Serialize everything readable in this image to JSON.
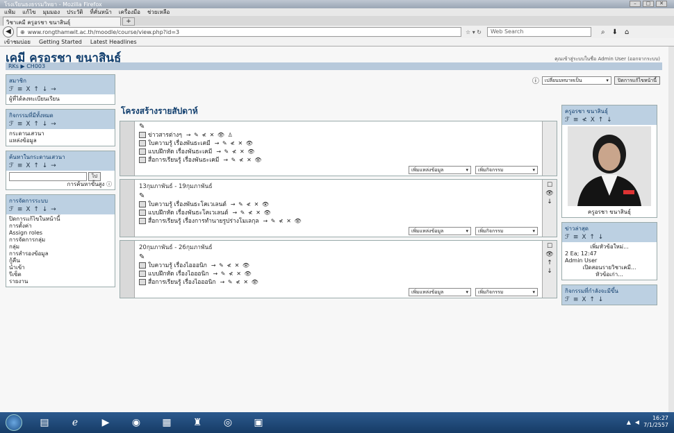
{
  "browser": {
    "title": "โรงเรียนธงธรรมวิทยา - Mozilla Firefox",
    "menu": [
      "แฟ้ม",
      "แก้ไข",
      "มุมมอง",
      "ประวัติ",
      "ที่คั่นหน้า",
      "เครื่องมือ",
      "ช่วยเหลือ"
    ],
    "tab_label": "วิชาเคมี ครูอรชา ขนาสินธุ์",
    "url": "www.rongthamwit.ac.th/moodle/course/view.php?id=3",
    "search_placeholder": "Web Search",
    "bookmarks": [
      "เข้าชมบ่อย",
      "Getting Started",
      "Latest Headlines"
    ]
  },
  "page": {
    "site_title": "เคมี ครูอรชา ขนาสินธุ์",
    "breadcrumb": "RKs ▶ CH003",
    "login_info": "คุณเข้าสู่ระบบในชื่อ Admin User (ออกจากระบบ)",
    "role_select": "เปลี่ยนบทบาทเป็น",
    "turn_edit_btn": "ปิดการแก้ไขหน้านี้"
  },
  "left_blocks": [
    {
      "title": "สมาชิก",
      "controls": "ℱ ≡ X ↑ ↓ →",
      "items": [
        "ผู้ที่ได้ลงทะเบียนเรียน"
      ]
    },
    {
      "title": "กิจกรรมที่มีทั้งหมด",
      "controls": "ℱ ≡ X ↑ ↓ →",
      "items": [
        "กระดานเสวนา",
        "แหล่งข้อมูล"
      ]
    },
    {
      "title": "ค้นหาในกระดานเสวนา",
      "controls": "ℱ ≡ X ↑ ↓ →",
      "search_btn": "ไป",
      "advanced": "การค้นหาขั้นสูง ⓘ"
    },
    {
      "title": "การจัดการระบบ",
      "controls": "ℱ ≡ X ↑ ↓ →",
      "items": [
        "ปิดการแก้ไขในหน้านี้",
        "การตั้งค่า",
        "Assign roles",
        "การจัดการกลุ่ม",
        "กลุ่ม",
        "การสำรองข้อมูล",
        "กู้คืน",
        "นำเข้า",
        "รีเซ็ต",
        "รายงาน"
      ]
    }
  ],
  "center": {
    "title": "โครงสร้างรายสัปดาห์",
    "add_resource": "เพิ่มแหล่งข้อมูล",
    "add_activity": "เพิ่มกิจกรรม",
    "sections": [
      {
        "heading": "",
        "activities": [
          "ข่าวสารต่างๆ",
          "ใบความรู้ เรื่องพันธะเคมี",
          "แบบฝึกหัด เรื่องพันธะเคมี",
          "สื่อการเรียนรู้ เรื่องพันธะเคมี"
        ]
      },
      {
        "heading": "13กุมภาพันธ์ - 19กุมภาพันธ์",
        "activities": [
          "ใบความรู้ เรื่องพันธะโคเวเลนต์",
          "แบบฝึกหัด เรื่องพันธะโคเวเลนต์",
          "สื่อการเรียนรู้ เรื่องการทำนายรูปร่างโมเลกุล"
        ]
      },
      {
        "heading": "20กุมภาพันธ์ - 26กุมภาพันธ์",
        "activities": [
          "ใบความรู้ เรื่องไอออนิก",
          "แบบฝึกหัด เรื่องไอออนิก",
          "สื่อการเรียนรู้ เรื่องไอออนิก"
        ]
      }
    ]
  },
  "right_blocks": [
    {
      "title": "ครูอรชา ขนาสินธุ์",
      "controls": "ℱ ≡ ≮ X ↑ ↓",
      "caption": "ครูอรชา ขนาสินธุ์"
    },
    {
      "title": "ข่าวล่าสุด",
      "controls": "ℱ ≡ X ↑ ↓",
      "add_topic": "เพิ่มหัวข้อใหม่...",
      "news_date": "2 Ea; 12:47",
      "news_user": "Admin User",
      "news_text": "เปิดสอนรายวิชาเคมี...",
      "news_more": "หัวข้อเก่า..."
    },
    {
      "title": "กิจกรรมที่กำลังจะมีขึ้น",
      "controls": "ℱ ≡ X ↑ ↓"
    }
  ],
  "taskbar": {
    "time": "16:27",
    "date": "7/1/2557",
    "icons": [
      "start-orb",
      "file-explorer",
      "internet-explorer",
      "media-player",
      "firefox",
      "powerpoint",
      "paint",
      "chrome",
      "notepad"
    ]
  }
}
